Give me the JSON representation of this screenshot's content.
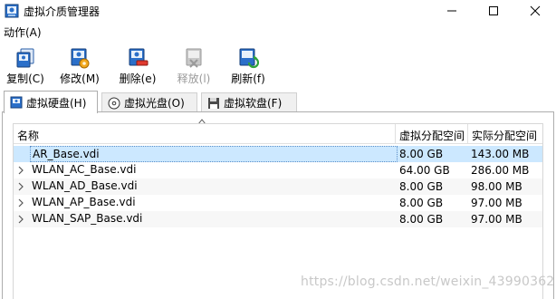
{
  "window": {
    "title": "虚拟介质管理器",
    "controls": {
      "minimize": "minimize",
      "maximize": "maximize",
      "close": "close"
    }
  },
  "menubar": {
    "items": [
      {
        "label": "动作(A)"
      }
    ]
  },
  "toolbar": {
    "items": [
      {
        "label": "复制(C)",
        "icon": "copy-disk-icon",
        "enabled": true
      },
      {
        "label": "修改(M)",
        "icon": "modify-disk-icon",
        "enabled": true
      },
      {
        "label": "删除(e)",
        "icon": "delete-disk-icon",
        "enabled": true
      },
      {
        "label": "释放(l)",
        "icon": "release-disk-icon",
        "enabled": false
      },
      {
        "label": "刷新(f)",
        "icon": "refresh-icon",
        "enabled": true
      }
    ]
  },
  "tabs": [
    {
      "label": "虚拟硬盘(H)",
      "icon": "hard-disk-icon",
      "active": true
    },
    {
      "label": "虚拟光盘(O)",
      "icon": "optical-disc-icon",
      "active": false
    },
    {
      "label": "虚拟软盘(F)",
      "icon": "floppy-disk-icon",
      "active": false
    }
  ],
  "table": {
    "columns": [
      "名称",
      "虚拟分配空间",
      "实际分配空间"
    ],
    "rows": [
      {
        "name": "AR_Base.vdi",
        "virtual_size": "8.00 GB",
        "actual_size": "143.00 MB",
        "selected": true,
        "expandable": false
      },
      {
        "name": "WLAN_AC_Base.vdi",
        "virtual_size": "64.00 GB",
        "actual_size": "286.00 MB",
        "selected": false,
        "expandable": true
      },
      {
        "name": "WLAN_AD_Base.vdi",
        "virtual_size": "8.00 GB",
        "actual_size": "98.00 MB",
        "selected": false,
        "expandable": true
      },
      {
        "name": "WLAN_AP_Base.vdi",
        "virtual_size": "8.00 GB",
        "actual_size": "97.00 MB",
        "selected": false,
        "expandable": true
      },
      {
        "name": "WLAN_SAP_Base.vdi",
        "virtual_size": "8.00 GB",
        "actual_size": "97.00 MB",
        "selected": false,
        "expandable": true
      }
    ]
  },
  "watermark": "https://blog.csdn.net/weixin_43990362",
  "colors": {
    "selection": "#cce8ff",
    "disabled_text": "#9a9a9a",
    "accent": "#1f6fc4"
  }
}
